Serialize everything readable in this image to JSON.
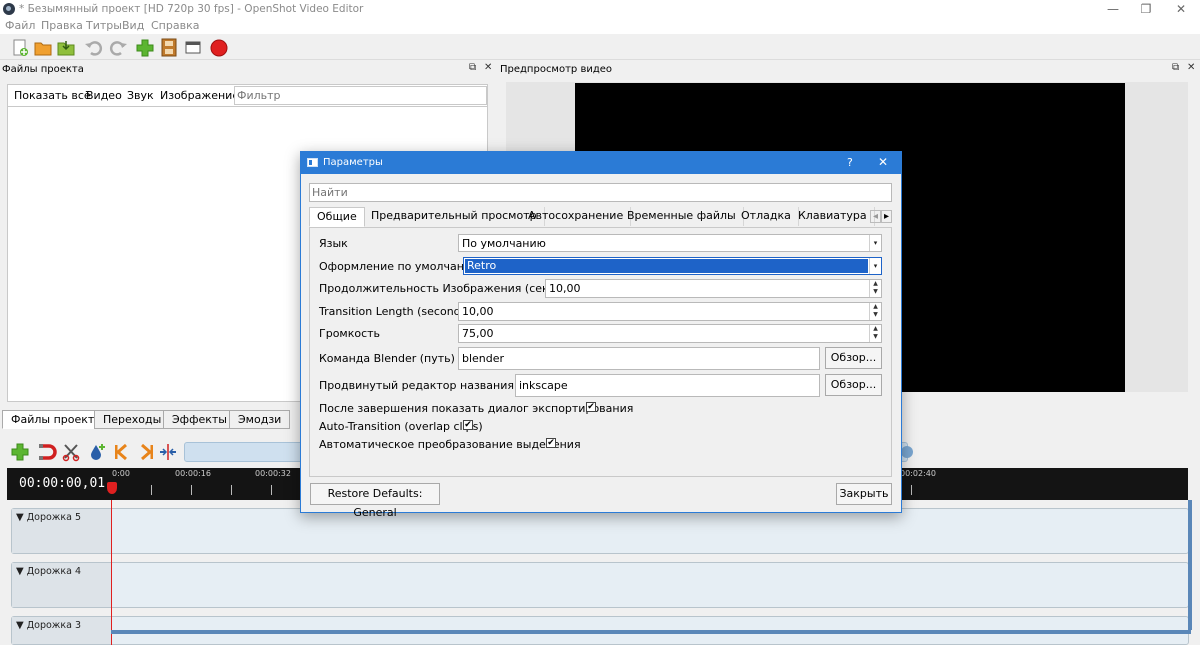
{
  "window": {
    "title": "* Безымянный проект [HD 720p 30 fps] - OpenShot Video Editor",
    "minimize_glyph": "—",
    "maximize_glyph": "❐",
    "close_glyph": "✕"
  },
  "menu": [
    "Файл",
    "Правка",
    "Титры",
    "Вид",
    "Справка"
  ],
  "files_panel": {
    "title": "Файлы проекта",
    "tabs": [
      "Показать всё",
      "Видео",
      "Звук",
      "Изображение"
    ],
    "filter_placeholder": "Фильтр"
  },
  "preview_panel": {
    "title": "Предпросмотр видео"
  },
  "dock_icons": {
    "float": "⧉",
    "close": "✕"
  },
  "bottom_tabs": [
    "Файлы проекта",
    "Переходы",
    "Эффекты",
    "Эмодзи"
  ],
  "timeline": {
    "timecode": "00:00:00,01",
    "ticks": [
      "0:00",
      "00:00:16",
      "00:00:32",
      "00:02:40"
    ],
    "tracks": [
      "Дорожка 5",
      "Дорожка 4",
      "Дорожка 3"
    ]
  },
  "dialog": {
    "title": "Параметры",
    "help_glyph": "?",
    "close_glyph": "✕",
    "search_placeholder": "Найти",
    "tabs": [
      "Общие",
      "Предварительный просмотр",
      "Автосохранение",
      "Временные файлы",
      "Отладка",
      "Клавиатура"
    ],
    "fields": {
      "language": {
        "label": "Язык",
        "value": "По умолчанию"
      },
      "theme": {
        "label": "Оформление по умолчанию",
        "value": "Retro"
      },
      "image_duration": {
        "label": "Продолжительность Изображения (секунды)",
        "value": "10,00"
      },
      "transition_length": {
        "label": "Transition Length (seconds)",
        "value": "10,00"
      },
      "volume": {
        "label": "Громкость",
        "value": "75,00"
      },
      "blender": {
        "label": "Команда Blender (путь)",
        "value": "blender",
        "browse": "Обзор..."
      },
      "title_editor": {
        "label": "Продвинутый редактор названия (путь)",
        "value": "inkscape",
        "browse": "Обзор..."
      }
    },
    "checkboxes": [
      {
        "label": "После завершения показать диалог экспортирования",
        "checked": true
      },
      {
        "label": "Auto-Transition (overlap clips)",
        "checked": true
      },
      {
        "label": "Автоматическое преобразование выделения",
        "checked": true
      }
    ],
    "restore_button": "Restore Defaults: General",
    "close_button": "Закрыть",
    "check_glyph": "✔",
    "arrow_glyph": "▾",
    "spin_up": "▲",
    "spin_down": "▼",
    "tab_left": "◂",
    "tab_right": "▸"
  },
  "colors": {
    "accent": "#2b7bd6",
    "selection": "#1e63c8",
    "playhead": "#e02020"
  }
}
